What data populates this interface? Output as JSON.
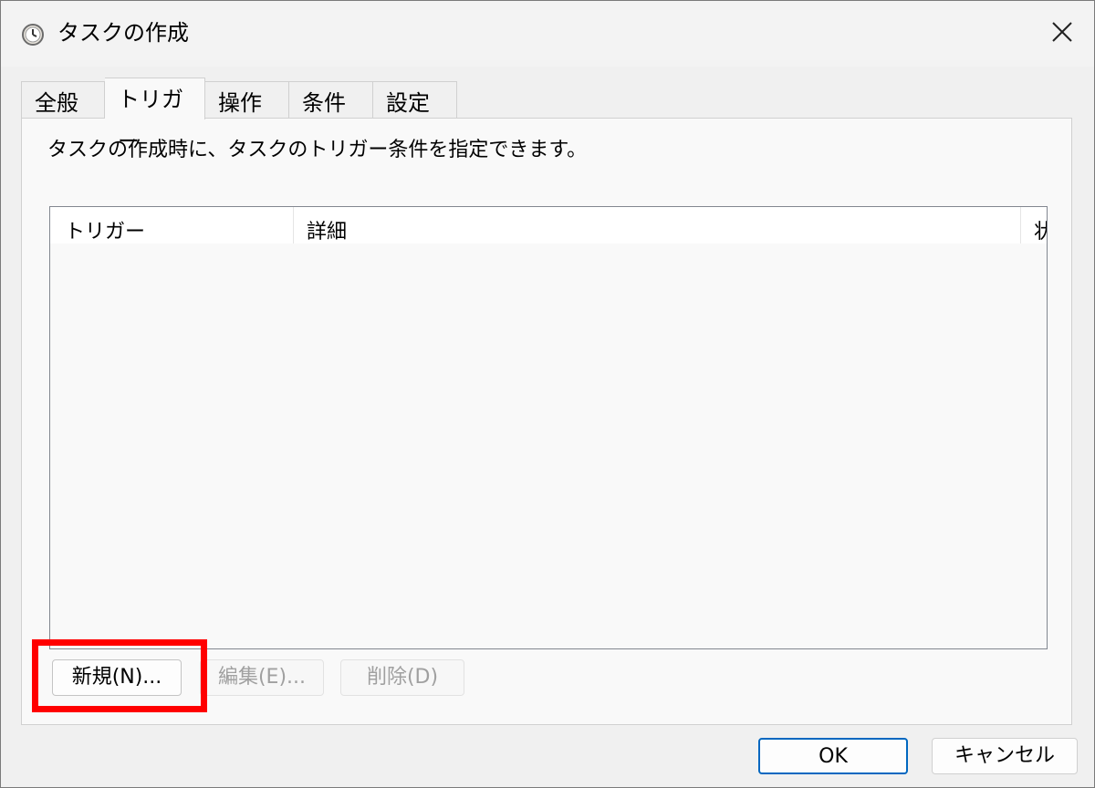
{
  "window": {
    "title": "タスクの作成",
    "icon": "task-scheduler-clock-icon",
    "close_icon": "close-icon"
  },
  "tabs": [
    {
      "label": "全般"
    },
    {
      "label": "トリガー",
      "active": true
    },
    {
      "label": "操作"
    },
    {
      "label": "条件"
    },
    {
      "label": "設定"
    }
  ],
  "trigger_panel": {
    "description": "タスクの作成時に、タスクのトリガー条件を指定できます。",
    "list": {
      "columns": [
        "トリガー",
        "詳細",
        "状"
      ],
      "rows": []
    },
    "buttons": {
      "new_label": "新規(N)...",
      "edit_label": "編集(E)...",
      "delete_label": "削除(D)"
    }
  },
  "dialog_buttons": {
    "ok_label": "OK",
    "cancel_label": "キャンセル"
  },
  "colors": {
    "highlight": "#ff0000",
    "default_button_border": "#0067c0"
  }
}
